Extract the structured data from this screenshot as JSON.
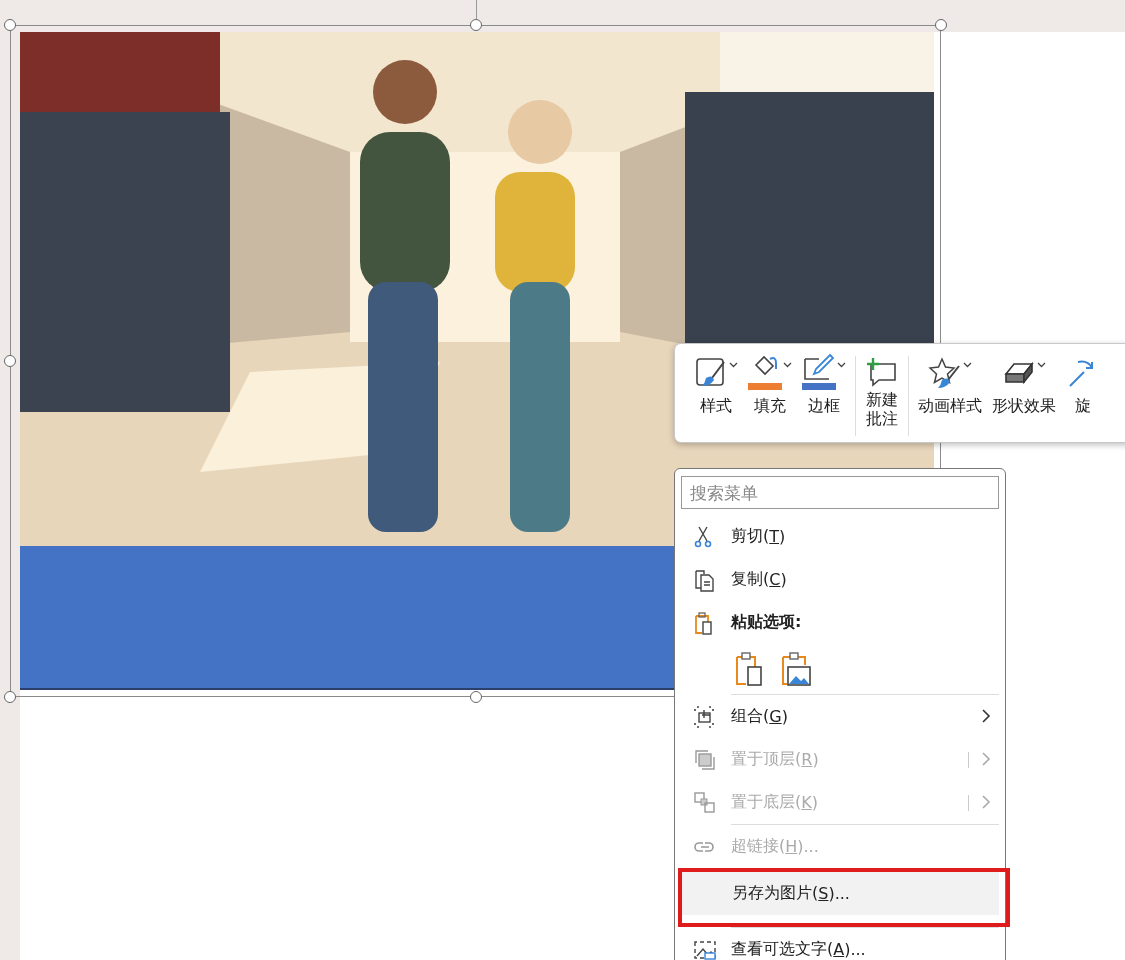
{
  "slide": {
    "selected": true
  },
  "toolbar": {
    "buttons": [
      {
        "label": "样式",
        "dropdown": true
      },
      {
        "label": "填充",
        "dropdown": true,
        "color": "#ed7d31"
      },
      {
        "label": "边框",
        "dropdown": true,
        "color": "#4472c4"
      },
      {
        "label": "新建批注",
        "dropdown": false
      },
      {
        "label": "动画样式",
        "dropdown": true
      },
      {
        "label": "形状效果",
        "dropdown": true
      },
      {
        "label": "旋",
        "dropdown": false
      }
    ]
  },
  "context_menu": {
    "search": {
      "placeholder": "搜索菜单"
    },
    "items": [
      {
        "kind": "item",
        "label": "剪切(T)",
        "disabled": false,
        "submenu": false,
        "highlighted": false,
        "annotated": false
      },
      {
        "kind": "item",
        "label": "复制(C)",
        "disabled": false,
        "submenu": false,
        "highlighted": false,
        "annotated": false
      },
      {
        "kind": "header",
        "label": "粘贴选项:"
      },
      {
        "kind": "paste-icons"
      },
      {
        "kind": "separator"
      },
      {
        "kind": "item",
        "label": "组合(G)",
        "disabled": false,
        "submenu": true,
        "highlighted": false,
        "annotated": false
      },
      {
        "kind": "item",
        "label": "置于顶层(R)",
        "disabled": true,
        "submenu": true,
        "highlighted": false,
        "annotated": false
      },
      {
        "kind": "item",
        "label": "置于底层(K)",
        "disabled": true,
        "submenu": true,
        "highlighted": false,
        "annotated": false
      },
      {
        "kind": "separator"
      },
      {
        "kind": "item",
        "label": "超链接(H)...",
        "disabled": true,
        "submenu": false,
        "highlighted": false,
        "annotated": false
      },
      {
        "kind": "item",
        "label": "另存为图片(S)...",
        "disabled": false,
        "submenu": false,
        "highlighted": true,
        "annotated": true
      },
      {
        "kind": "separator"
      },
      {
        "kind": "item",
        "label": "查看可选文字(A)...",
        "disabled": false,
        "submenu": false,
        "highlighted": false,
        "annotated": false
      }
    ]
  }
}
